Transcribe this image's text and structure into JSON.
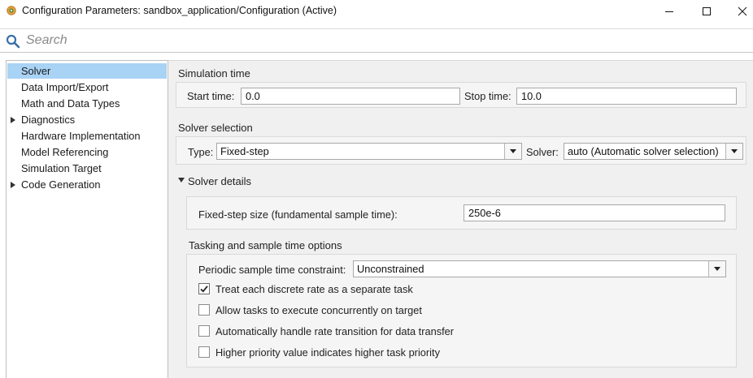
{
  "window": {
    "title": "Configuration Parameters: sandbox_application/Configuration (Active)",
    "icon": "simulink-gear-icon",
    "controls": {
      "minimize": "minimize-icon",
      "maximize": "maximize-icon",
      "close": "close-icon"
    }
  },
  "search": {
    "placeholder": "Search",
    "icon": "search-icon",
    "icon_color": "#3a6fa8"
  },
  "sidebar": {
    "selected_color": "#a9d3f5",
    "items": [
      {
        "label": "Solver",
        "selected": true,
        "expandable": false
      },
      {
        "label": "Data Import/Export",
        "selected": false,
        "expandable": false
      },
      {
        "label": "Math and Data Types",
        "selected": false,
        "expandable": false
      },
      {
        "label": "Diagnostics",
        "selected": false,
        "expandable": true
      },
      {
        "label": "Hardware Implementation",
        "selected": false,
        "expandable": false
      },
      {
        "label": "Model Referencing",
        "selected": false,
        "expandable": false
      },
      {
        "label": "Simulation Target",
        "selected": false,
        "expandable": false
      },
      {
        "label": "Code Generation",
        "selected": false,
        "expandable": true
      }
    ]
  },
  "simulation_time": {
    "title": "Simulation time",
    "start_label": "Start time:",
    "start_value": "0.0",
    "stop_label": "Stop time:",
    "stop_value": "10.0"
  },
  "solver_selection": {
    "title": "Solver selection",
    "type_label": "Type:",
    "type_value": "Fixed-step",
    "solver_label": "Solver:",
    "solver_value": "auto (Automatic solver selection)"
  },
  "solver_details": {
    "title": "Solver details",
    "expanded": true,
    "step_size_label": "Fixed-step size (fundamental sample time):",
    "step_size_value": "250e-6"
  },
  "tasking": {
    "title": "Tasking and sample time options",
    "constraint_label": "Periodic sample time constraint:",
    "constraint_value": "Unconstrained",
    "options": [
      {
        "label": "Treat each discrete rate as a separate task",
        "checked": true
      },
      {
        "label": "Allow tasks to execute concurrently on target",
        "checked": false
      },
      {
        "label": "Automatically handle rate transition for data transfer",
        "checked": false
      },
      {
        "label": "Higher priority value indicates higher task priority",
        "checked": false
      }
    ]
  }
}
